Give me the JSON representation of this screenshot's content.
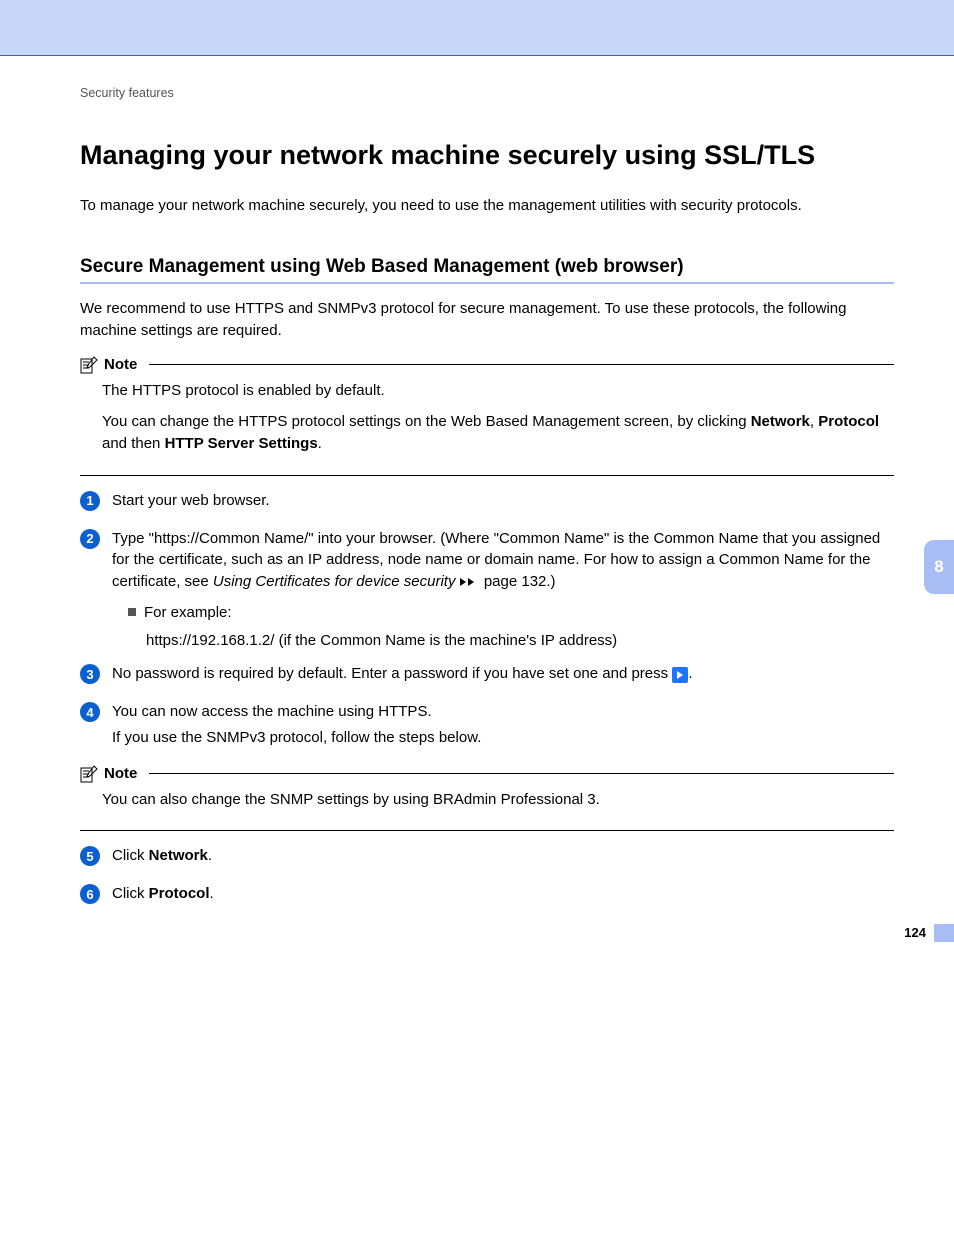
{
  "breadcrumb": "Security features",
  "title": "Managing your network machine securely using SSL/TLS",
  "intro": "To manage your network machine securely, you need to use the management utilities with security protocols.",
  "section_heading": "Secure Management using Web Based Management (web browser)",
  "section_intro": "We recommend to use HTTPS and SNMPv3 protocol for secure management. To use these protocols, the following machine settings are required.",
  "note_label": "Note",
  "note1": {
    "line1": "The HTTPS protocol is enabled by default.",
    "line2_pre": "You can change the HTTPS protocol settings on the Web Based Management screen, by clicking ",
    "line2_b1": "Network",
    "line2_sep1": ", ",
    "line2_b2": "Protocol",
    "line2_mid": " and then ",
    "line2_b3": "HTTP Server Settings",
    "line2_end": "."
  },
  "steps": {
    "s1": "Start your web browser.",
    "s2_main_pre": "Type \"https://Common Name/\" into your browser. (Where \"Common Name\" is the Common Name that you assigned for the certificate, such as an IP address, node name or domain name. For how to assign a Common Name for the certificate, see ",
    "s2_xref_italic": "Using Certificates for device security",
    "s2_xref_page": " page 132.)",
    "s2_sub_label": "For example:",
    "s2_sub_example": "https://192.168.1.2/ (if the Common Name is the machine's IP address)",
    "s3_pre": "No password is required by default. Enter a password if you have set one and press ",
    "s3_post": ".",
    "s4_line1": "You can now access the machine using HTTPS.",
    "s4_line2": "If you use the SNMPv3 protocol, follow the steps below.",
    "s5_pre": "Click ",
    "s5_bold": "Network",
    "s5_post": ".",
    "s6_pre": "Click ",
    "s6_bold": "Protocol",
    "s6_post": "."
  },
  "note2": {
    "text": "You can also change the SNMP settings by using BRAdmin Professional 3."
  },
  "side_tab": "8",
  "page_number": "124"
}
